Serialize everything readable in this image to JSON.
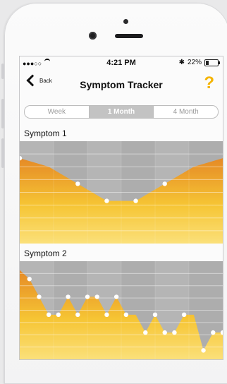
{
  "status_bar": {
    "signal": "●●●○○",
    "time": "4:21 PM",
    "battery_percent": "22%",
    "battery_level": 0.22
  },
  "nav": {
    "back_label": "Back",
    "title": "Symptom Tracker",
    "help_label": "?"
  },
  "tabs": [
    {
      "label": "Week",
      "selected": false
    },
    {
      "label": "1 Month",
      "selected": true
    },
    {
      "label": "4 Month",
      "selected": false
    }
  ],
  "colors": {
    "accent": "#f5b400",
    "chart_orange": "#e58a26",
    "chart_yellow": "#f6c534",
    "chart_background": "#adadad"
  },
  "chart_data": [
    {
      "type": "area",
      "title": "Symptom 1",
      "x": [
        0,
        1,
        2,
        3,
        4,
        5,
        6,
        7
      ],
      "y": [
        10,
        9,
        7,
        5,
        5,
        7,
        9,
        10
      ],
      "markers": [
        0,
        2,
        3,
        4,
        5
      ],
      "ylim": [
        0,
        12
      ]
    },
    {
      "type": "area",
      "title": "Symptom 2",
      "x": [
        0,
        1,
        2,
        3,
        4,
        5,
        6,
        7,
        8,
        9,
        10,
        11,
        12,
        13,
        14,
        15,
        16,
        17,
        18,
        19,
        20,
        21
      ],
      "y": [
        10,
        9,
        7,
        5,
        5,
        7,
        5,
        7,
        7,
        5,
        7,
        5,
        5,
        3,
        5,
        3,
        3,
        5,
        5,
        1,
        3,
        3
      ],
      "markers": [
        1,
        2,
        3,
        4,
        5,
        6,
        7,
        8,
        9,
        10,
        11,
        13,
        14,
        15,
        16,
        17,
        19,
        20,
        21
      ],
      "ylim": [
        0,
        11
      ]
    }
  ]
}
